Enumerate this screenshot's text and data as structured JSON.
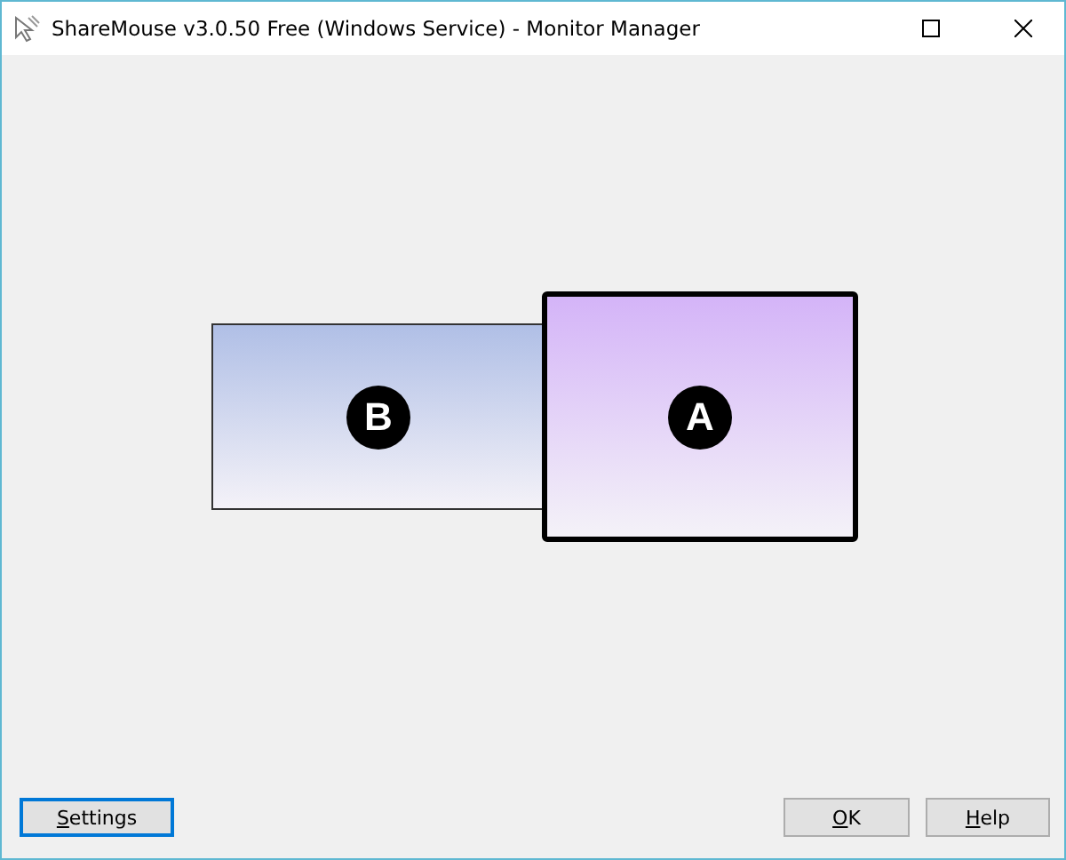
{
  "window": {
    "title": "ShareMouse v3.0.50 Free (Windows Service) - Monitor Manager"
  },
  "monitors": [
    {
      "label": "B",
      "selected": false,
      "color": "#b0bfe6"
    },
    {
      "label": "A",
      "selected": true,
      "color": "#d4b4f8"
    }
  ],
  "buttons": [
    {
      "label": "Settings",
      "focused": true
    },
    {
      "label": "OK",
      "focused": false
    },
    {
      "label": "Help",
      "focused": false
    }
  ]
}
